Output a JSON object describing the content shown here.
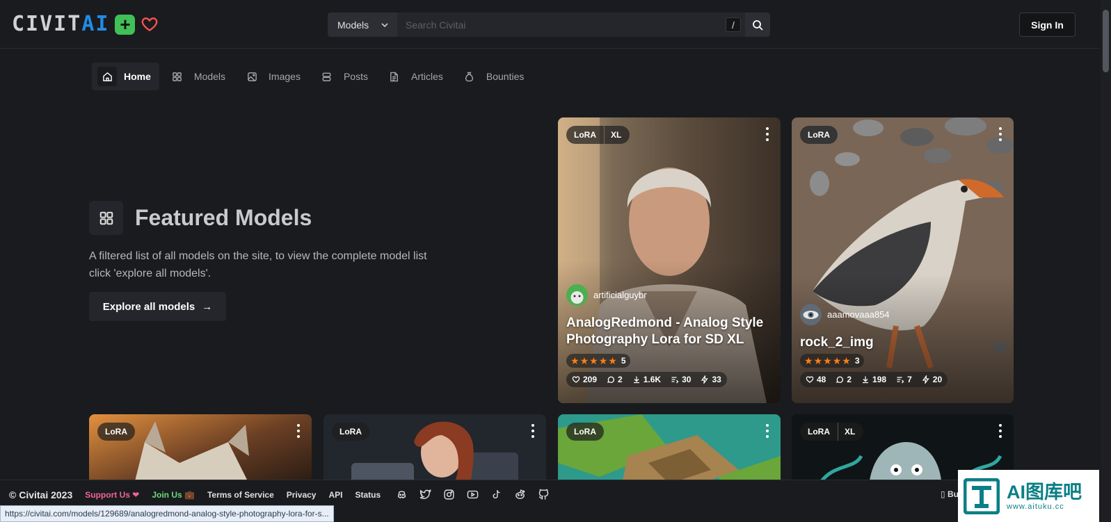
{
  "header": {
    "logo_text_a": "CIVIT",
    "logo_text_b": "AI",
    "logo_plus": "+",
    "search_category": "Models",
    "search_placeholder": "Search Civitai",
    "search_shortcut": "/",
    "signin_label": "Sign In"
  },
  "nav": {
    "items": [
      {
        "label": "Home",
        "icon": "home-icon"
      },
      {
        "label": "Models",
        "icon": "grid-icon"
      },
      {
        "label": "Images",
        "icon": "image-icon"
      },
      {
        "label": "Posts",
        "icon": "layers-icon"
      },
      {
        "label": "Articles",
        "icon": "file-text-icon"
      },
      {
        "label": "Bounties",
        "icon": "moneybag-icon"
      }
    ]
  },
  "featured": {
    "title": "Featured Models",
    "description": "A filtered list of all models on the site, to view the complete model list click 'explore all models'.",
    "explore_label": "Explore all models",
    "explore_arrow": "→"
  },
  "cards": [
    {
      "badges": [
        "LoRA",
        "XL"
      ],
      "user": "artificialguybr",
      "title": "AnalogRedmond - Analog Style Photography Lora for SD XL",
      "rating_count": "5",
      "stats": {
        "likes": "209",
        "comments": "2",
        "downloads": "1.6K",
        "images": "30",
        "tips": "33"
      }
    },
    {
      "badges": [
        "LoRA"
      ],
      "user": "aaamovaaa854",
      "title": "rock_2_img",
      "rating_count": "3",
      "stats": {
        "likes": "48",
        "comments": "2",
        "downloads": "198",
        "images": "7",
        "tips": "20"
      }
    },
    {
      "badges": [
        "LoRA"
      ]
    },
    {
      "badges": [
        "LoRA"
      ]
    },
    {
      "badges": [
        "LoRA"
      ]
    },
    {
      "badges": [
        "LoRA",
        "XL"
      ]
    }
  ],
  "footer": {
    "copyright": "© Civitai 2023",
    "support": "Support Us ❤",
    "join": "Join Us 💼",
    "links": [
      "Terms of Service",
      "Privacy",
      "API",
      "Status"
    ],
    "bugs": "▯ Bu"
  },
  "status_url": "https://civitai.com/models/129689/analogredmond-analog-style-photography-lora-for-s...",
  "watermark": {
    "title": "AI图库吧",
    "url": "www.aituku.cc"
  },
  "colors": {
    "bg": "#1a1b1e",
    "accent_blue": "#228be6",
    "green": "#40c057",
    "heart": "#fa5252",
    "star": "#fd7e14"
  }
}
